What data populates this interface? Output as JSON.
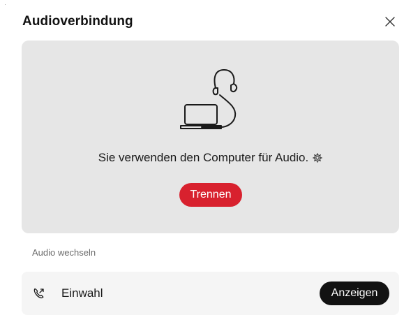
{
  "dialog": {
    "title": "Audioverbindung",
    "close_icon": "close-icon"
  },
  "audio_panel": {
    "illustration": "laptop-headset-icon",
    "status_text": "Sie verwenden den Computer für Audio.",
    "settings_icon": "gear-icon",
    "disconnect_label": "Trennen",
    "disconnect_color": "#d8212e"
  },
  "switch_audio": {
    "section_label": "Audio wechseln",
    "options": [
      {
        "icon": "phone-dial-in-icon",
        "label": "Einwahl",
        "action_label": "Anzeigen"
      }
    ]
  }
}
